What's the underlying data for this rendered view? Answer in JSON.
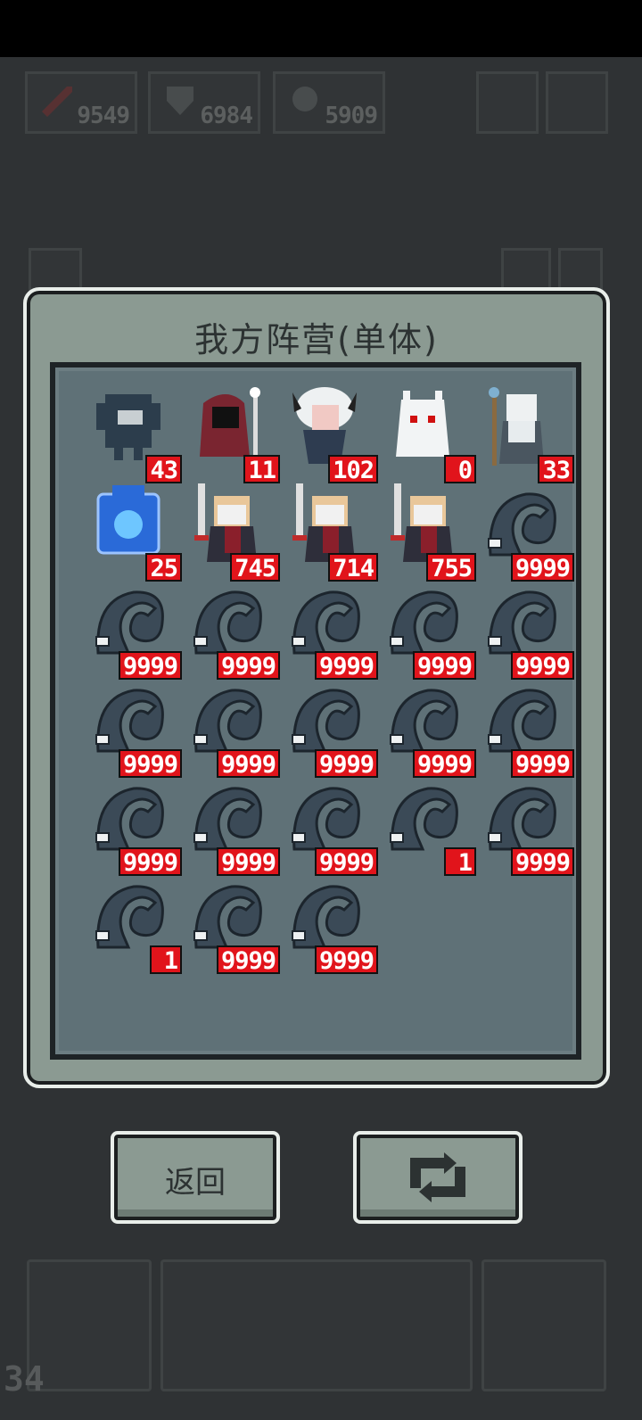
{
  "hud": {
    "resources": [
      {
        "icon": "sword-icon",
        "value": "9549"
      },
      {
        "icon": "shield-icon",
        "value": "6984"
      },
      {
        "icon": "magic-icon",
        "value": "5909"
      }
    ],
    "counter": "34"
  },
  "modal": {
    "title": "我方阵营(单体)"
  },
  "units": [
    {
      "sprite": "dark-beast",
      "count": "43"
    },
    {
      "sprite": "hooded-mage",
      "count": "11"
    },
    {
      "sprite": "white-haired-demon",
      "count": "102"
    },
    {
      "sprite": "white-ghost",
      "count": "0"
    },
    {
      "sprite": "old-sage",
      "count": "33"
    },
    {
      "sprite": "blue-crystal",
      "count": "25"
    },
    {
      "sprite": "lion-knight",
      "count": "745"
    },
    {
      "sprite": "lion-knight",
      "count": "714"
    },
    {
      "sprite": "lion-knight",
      "count": "755"
    },
    {
      "sprite": "swirl-slime",
      "count": "9999"
    },
    {
      "sprite": "swirl-slime",
      "count": "9999"
    },
    {
      "sprite": "swirl-slime",
      "count": "9999"
    },
    {
      "sprite": "swirl-slime",
      "count": "9999"
    },
    {
      "sprite": "swirl-slime",
      "count": "9999"
    },
    {
      "sprite": "swirl-slime",
      "count": "9999"
    },
    {
      "sprite": "swirl-slime",
      "count": "9999"
    },
    {
      "sprite": "swirl-slime",
      "count": "9999"
    },
    {
      "sprite": "swirl-slime",
      "count": "9999"
    },
    {
      "sprite": "swirl-slime",
      "count": "9999"
    },
    {
      "sprite": "swirl-slime",
      "count": "9999"
    },
    {
      "sprite": "swirl-slime",
      "count": "9999"
    },
    {
      "sprite": "swirl-slime",
      "count": "9999"
    },
    {
      "sprite": "swirl-slime",
      "count": "9999"
    },
    {
      "sprite": "swirl-slime",
      "count": "1"
    },
    {
      "sprite": "swirl-slime",
      "count": "9999"
    },
    {
      "sprite": "swirl-slime",
      "count": "1"
    },
    {
      "sprite": "swirl-slime",
      "count": "9999"
    },
    {
      "sprite": "swirl-slime",
      "count": "9999"
    }
  ],
  "buttons": {
    "back_label": "返回",
    "swap_icon": "swap-icon"
  },
  "colors": {
    "badge": "#e1141b",
    "panel": "#5f7177",
    "frame": "#8b9a92"
  }
}
